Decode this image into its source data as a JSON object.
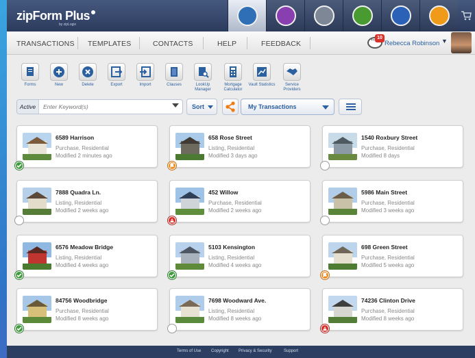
{
  "app": {
    "logo": "zipForm Plus",
    "logo_sub": "by zipLogix"
  },
  "app_tiles": [
    {
      "icon": "transactions-app-icon",
      "color": "#2f6fb5",
      "active": true
    },
    {
      "icon": "forms-app-icon",
      "color": "#8a3fb0",
      "active": false
    },
    {
      "icon": "docs-app-icon",
      "color": "#7d8796",
      "active": false
    },
    {
      "icon": "contacts-app-icon",
      "color": "#4a9a32",
      "active": false
    },
    {
      "icon": "mobile-app-icon",
      "color": "#2b62b8",
      "active": false
    },
    {
      "icon": "sync-app-icon",
      "color": "#f09a1a",
      "active": false
    }
  ],
  "nav": {
    "items": [
      "TRANSACTIONS",
      "TEMPLATES",
      "CONTACTS",
      "HELP",
      "FEEDBACK"
    ],
    "notification_count": "10",
    "user_name": "Rebecca Robinson"
  },
  "toolbar": [
    {
      "label": "Forms",
      "icon": "forms-icon"
    },
    {
      "label": "New",
      "icon": "plus-icon"
    },
    {
      "label": "Delete",
      "icon": "x-icon"
    },
    {
      "label": "Export",
      "icon": "export-icon"
    },
    {
      "label": "Import",
      "icon": "import-icon"
    },
    {
      "label": "Clauses",
      "icon": "clauses-icon"
    },
    {
      "label": "LookUp Manager",
      "icon": "lookup-icon"
    },
    {
      "label": "Mortgage Calculator",
      "icon": "calculator-icon"
    },
    {
      "label": "Vault Statistics",
      "icon": "chart-icon"
    },
    {
      "label": "Service Providers",
      "icon": "handshake-icon"
    }
  ],
  "search": {
    "active_label": "Active",
    "placeholder": "Enter Keyword(s)",
    "sort_label": "Sort",
    "filter_label": "My Transactions"
  },
  "transactions": [
    {
      "title": "6589 Harrison",
      "type": "Purchase, Residential",
      "modified": "Modified 2 minutes ago",
      "status": "green"
    },
    {
      "title": "658 Rose Street",
      "type": "Listing, Residential",
      "modified": "Modified 3 days ago",
      "status": "orange"
    },
    {
      "title": "1540 Roxbury Street",
      "type": "Purchase, Residential",
      "modified": "Modified 8 days",
      "status": "empty"
    },
    {
      "title": "7888 Quadra Ln.",
      "type": "Listing, Residential",
      "modified": "Modified 2 weeks ago",
      "status": "empty"
    },
    {
      "title": "452 Willow",
      "type": "Purchase, Residential",
      "modified": "Modified 2 weeks ago",
      "status": "red"
    },
    {
      "title": "5986 Main Street",
      "type": "Purchase, Residential",
      "modified": "Modified 3 weeks ago",
      "status": "empty"
    },
    {
      "title": "6576 Meadow Bridge",
      "type": "Listing, Residential",
      "modified": "Modified 4 weeks ago",
      "status": "green"
    },
    {
      "title": "5103 Kensington",
      "type": "Listing, Residential",
      "modified": "Modified 4 weeks ago",
      "status": "green"
    },
    {
      "title": "698 Green Street",
      "type": "Purchase, Residential",
      "modified": "Modified 5 weeks ago",
      "status": "orange"
    },
    {
      "title": "84756 Woodbridge",
      "type": "Purchase, Residential",
      "modified": "Modified 8 weeks ago",
      "status": "green"
    },
    {
      "title": "7698 Woodward Ave.",
      "type": "Listing, Residential",
      "modified": "Modified 8 weeks ago",
      "status": "empty"
    },
    {
      "title": "74236 Clinton Drive",
      "type": "Purchase, Residential",
      "modified": "Modified 8 weeks ago",
      "status": "red"
    }
  ],
  "footer": {
    "links": [
      "Terms of Use",
      "Copyright",
      "Privacy & Security",
      "Support"
    ]
  },
  "colors": {
    "header": "#2b3b5d",
    "link": "#2a5fa0",
    "status_green": "#3f9b3e",
    "status_orange": "#f08a1e",
    "status_red": "#d9322b"
  }
}
